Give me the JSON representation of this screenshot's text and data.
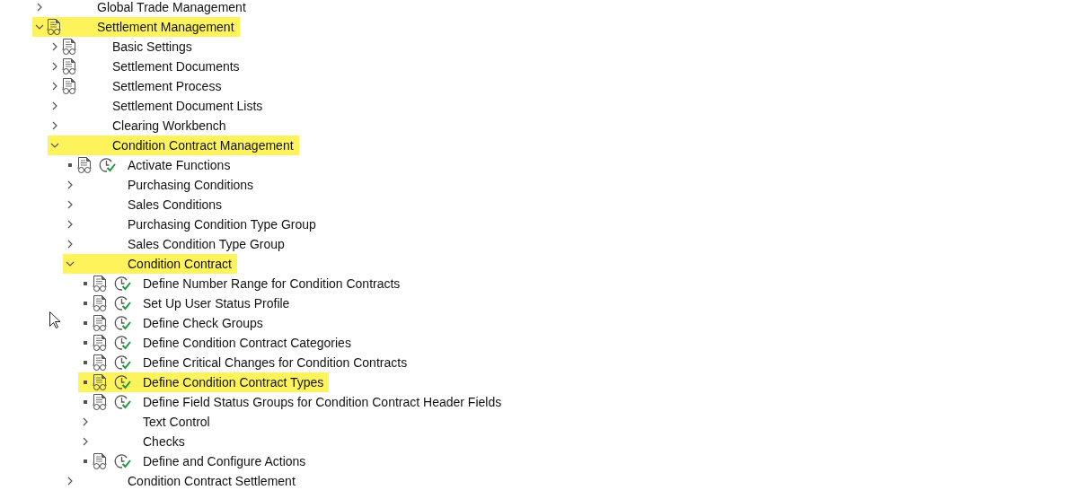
{
  "tree": [
    {
      "label": "Global Trade Management",
      "kind": "folder",
      "expanded": false,
      "documented": false,
      "highlighted": false
    },
    {
      "label": "Settlement Management",
      "kind": "folder",
      "expanded": true,
      "documented": true,
      "highlighted": true,
      "children": [
        {
          "label": "Basic Settings",
          "kind": "folder",
          "expanded": false,
          "documented": true,
          "highlighted": false
        },
        {
          "label": "Settlement Documents",
          "kind": "folder",
          "expanded": false,
          "documented": true,
          "highlighted": false
        },
        {
          "label": "Settlement Process",
          "kind": "folder",
          "expanded": false,
          "documented": true,
          "highlighted": false
        },
        {
          "label": "Settlement Document Lists",
          "kind": "folder",
          "expanded": false,
          "documented": false,
          "highlighted": false
        },
        {
          "label": "Clearing Workbench",
          "kind": "folder",
          "expanded": false,
          "documented": false,
          "highlighted": false
        },
        {
          "label": "Condition Contract Management",
          "kind": "folder",
          "expanded": true,
          "documented": false,
          "highlighted": true,
          "children": [
            {
              "label": "Activate Functions",
              "kind": "activity",
              "documented": true,
              "highlighted": false
            },
            {
              "label": "Purchasing Conditions",
              "kind": "folder",
              "expanded": false,
              "documented": false,
              "highlighted": false
            },
            {
              "label": "Sales Conditions",
              "kind": "folder",
              "expanded": false,
              "documented": false,
              "highlighted": false
            },
            {
              "label": "Purchasing Condition Type Group",
              "kind": "folder",
              "expanded": false,
              "documented": false,
              "highlighted": false
            },
            {
              "label": "Sales Condition Type Group",
              "kind": "folder",
              "expanded": false,
              "documented": false,
              "highlighted": false
            },
            {
              "label": "Condition Contract",
              "kind": "folder",
              "expanded": true,
              "documented": false,
              "highlighted": true,
              "children": [
                {
                  "label": "Define Number Range for Condition Contracts",
                  "kind": "activity",
                  "documented": true,
                  "highlighted": false
                },
                {
                  "label": "Set Up User Status Profile",
                  "kind": "activity",
                  "documented": true,
                  "highlighted": false
                },
                {
                  "label": "Define Check Groups",
                  "kind": "activity",
                  "documented": true,
                  "highlighted": false
                },
                {
                  "label": "Define Condition Contract Categories",
                  "kind": "activity",
                  "documented": true,
                  "highlighted": false
                },
                {
                  "label": "Define Critical Changes for Condition Contracts",
                  "kind": "activity",
                  "documented": true,
                  "highlighted": false
                },
                {
                  "label": "Define Condition Contract Types",
                  "kind": "activity",
                  "documented": true,
                  "highlighted": true
                },
                {
                  "label": "Define Field Status Groups for Condition Contract Header Fields",
                  "kind": "activity",
                  "documented": true,
                  "highlighted": false
                },
                {
                  "label": "Text Control",
                  "kind": "folder",
                  "expanded": false,
                  "documented": false,
                  "highlighted": false
                },
                {
                  "label": "Checks",
                  "kind": "folder",
                  "expanded": false,
                  "documented": false,
                  "highlighted": false
                },
                {
                  "label": "Define and Configure Actions",
                  "kind": "activity",
                  "documented": true,
                  "highlighted": false
                }
              ]
            },
            {
              "label": "Condition Contract Settlement",
              "kind": "folder",
              "expanded": false,
              "documented": false,
              "highlighted": false
            }
          ]
        }
      ]
    }
  ]
}
